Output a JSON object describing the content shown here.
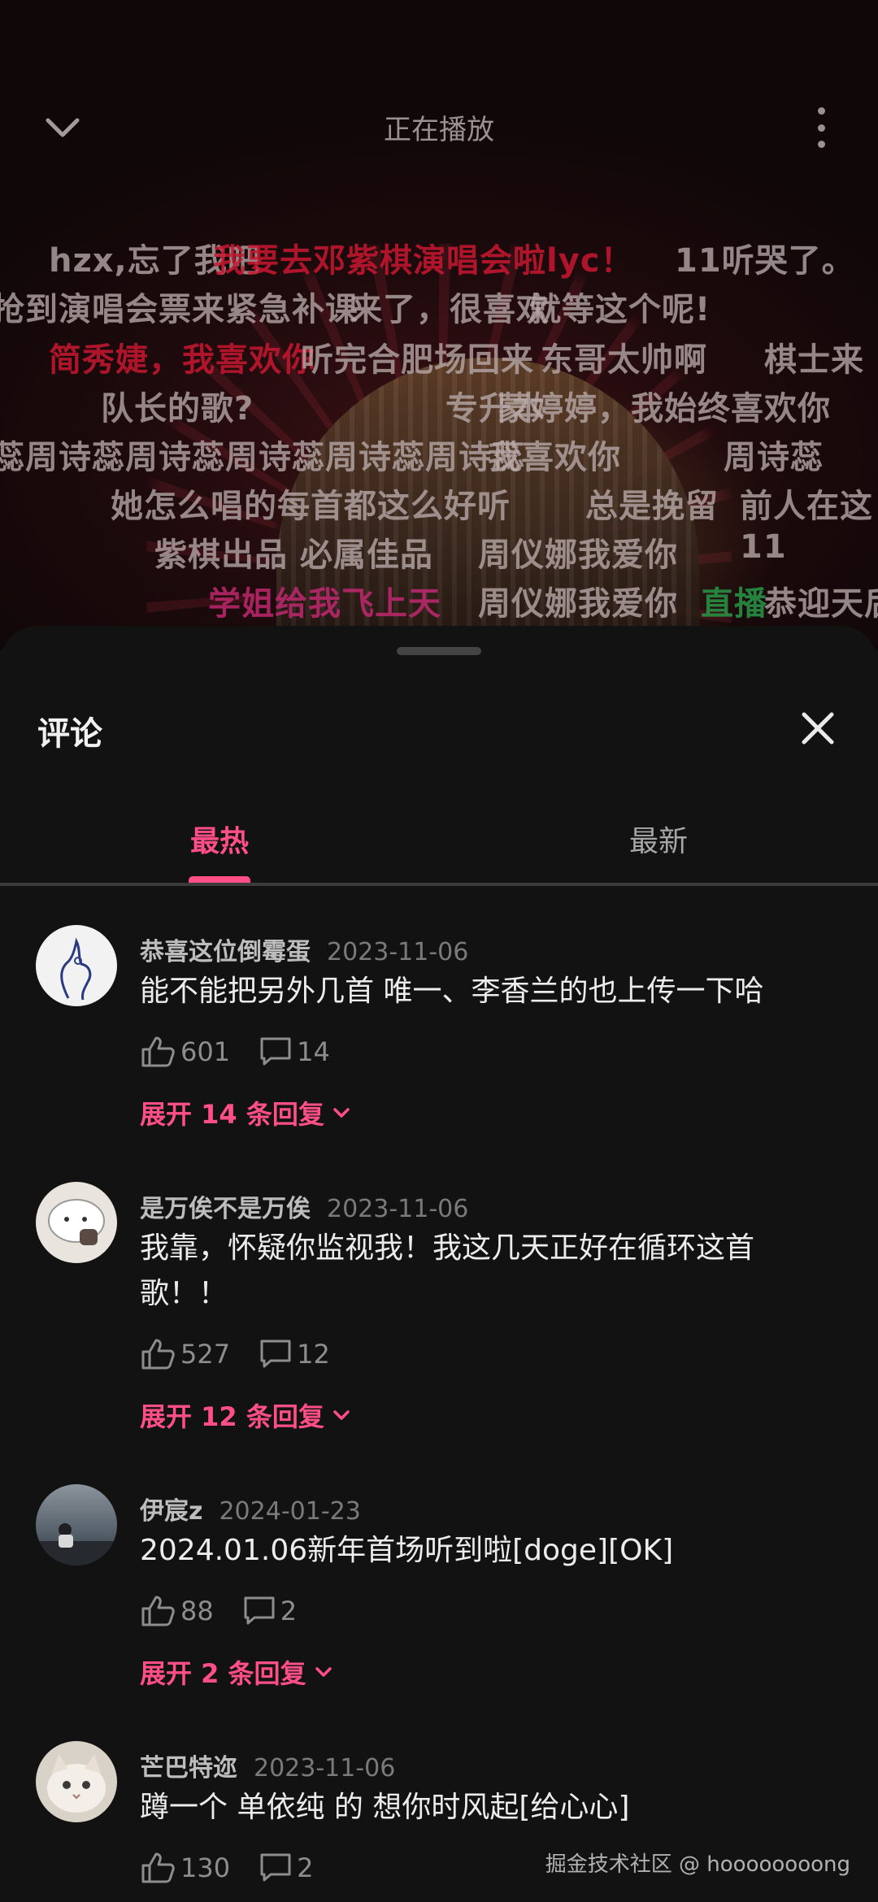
{
  "header": {
    "title": "正在播放"
  },
  "danmaku": [
    {
      "text": "hzx,忘了我吧",
      "color": "gray"
    },
    {
      "text": "我要去邓紫棋演唱会啦lyc！",
      "color": "red"
    },
    {
      "text": "11听哭了。",
      "color": "gray"
    },
    {
      "text": "抢到演唱会票来紧急补课",
      "color": "gray"
    },
    {
      "text": "来了，很喜欢",
      "color": "gray"
    },
    {
      "text": "就等这个呢!",
      "color": "gray"
    },
    {
      "text": "简秀婕，我喜欢你",
      "color": "red"
    },
    {
      "text": "听完合肥场回来",
      "color": "gray"
    },
    {
      "text": "东哥太帅啊",
      "color": "gray"
    },
    {
      "text": "棋士来",
      "color": "gray"
    },
    {
      "text": "队长的歌?",
      "color": "gray"
    },
    {
      "text": "专升本",
      "color": "gray"
    },
    {
      "text": "蒙婷婷，我始终喜欢你",
      "color": "gray"
    },
    {
      "text": "蕊周诗蕊周诗蕊周诗蕊周诗蕊周诗蕊",
      "color": "gray"
    },
    {
      "text": "我喜欢你",
      "color": "gray"
    },
    {
      "text": "周诗蕊",
      "color": "gray"
    },
    {
      "text": "她怎么唱的每首都这么好听",
      "color": "gray"
    },
    {
      "text": "总是挽留",
      "color": "gray"
    },
    {
      "text": "前人在这",
      "color": "gray"
    },
    {
      "text": "紫棋出品 必属佳品",
      "color": "gray"
    },
    {
      "text": "周仪娜我爱你",
      "color": "gray"
    },
    {
      "text": "11",
      "color": "gray"
    },
    {
      "text": "学姐给我飞上天",
      "color": "pink"
    },
    {
      "text": "周仪娜我爱你",
      "color": "gray"
    },
    {
      "text": "直播",
      "color": "green"
    },
    {
      "text": "恭迎天后",
      "color": "gray"
    }
  ],
  "sheet": {
    "title": "评论",
    "tabs": [
      {
        "label": "最热"
      },
      {
        "label": "最新"
      }
    ]
  },
  "comments": [
    {
      "user": "恭喜这位倒霉蛋",
      "date": "2023-11-06",
      "text": "能不能把另外几首 唯一、李香兰的也上传一下哈",
      "likes": "601",
      "replies": "14",
      "expand": "展开 14 条回复"
    },
    {
      "user": "是万俟不是万俟",
      "date": "2023-11-06",
      "text": "我靠，怀疑你监视我！我这几天正好在循环这首歌！！",
      "likes": "527",
      "replies": "12",
      "expand": "展开 12 条回复"
    },
    {
      "user": "伊宸z",
      "date": "2024-01-23",
      "text": "2024.01.06新年首场听到啦[doge][OK]",
      "likes": "88",
      "replies": "2",
      "expand": "展开 2 条回复"
    },
    {
      "user": "芒巴特迩",
      "date": "2023-11-06",
      "text": "蹲一个 单依纯 的 想你时风起[给心心]",
      "likes": "130",
      "replies": "2"
    }
  ],
  "watermark": "掘金技术社区 @ hoooooooong",
  "colors": {
    "accent": "#ff4f86",
    "background": "#121212"
  }
}
